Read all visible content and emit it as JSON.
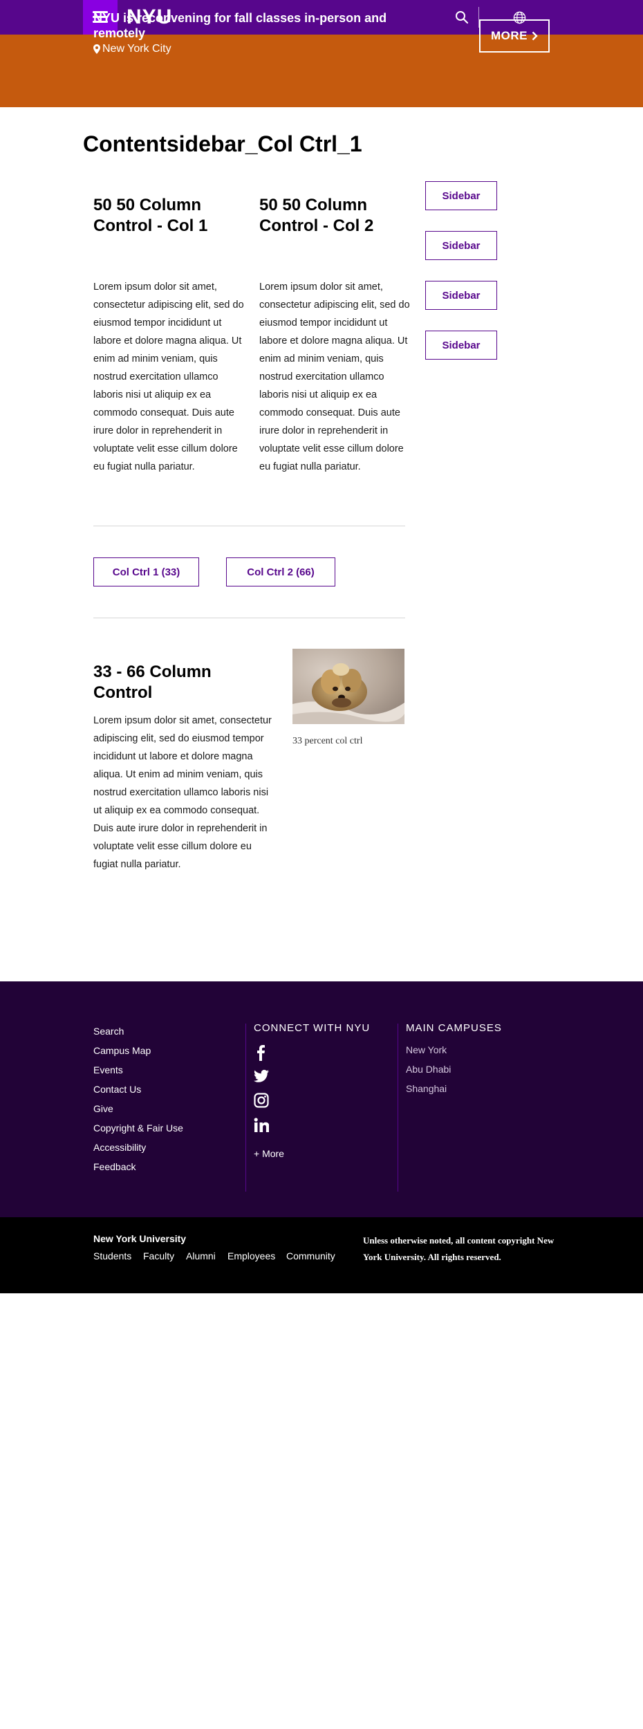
{
  "header": {
    "brand": "NYU",
    "menu_icon": "hamburger-menu-icon",
    "search_icon": "search-icon",
    "language_icon": "globe-icon",
    "colors": {
      "primary": "#57068c",
      "menu_accent": "#8900e1"
    }
  },
  "banner": {
    "title": "NYU is reconvening for fall classes in-person and remotely",
    "location": "New York City",
    "location_icon": "map-pin-icon",
    "more_label": "MORE",
    "more_icon": "chevron-right-icon",
    "color": "#c55a0e"
  },
  "main": {
    "page_title": "Contentsidebar_Col Ctrl_1",
    "col1": {
      "heading": "50 50 Column Control - Col 1",
      "body": "Lorem ipsum dolor sit amet, consectetur adipiscing elit, sed do eiusmod tempor incididunt ut labore et dolore magna aliqua. Ut enim ad minim veniam, quis nostrud exercitation ullamco laboris nisi ut aliquip ex ea commodo consequat. Duis aute irure dolor in reprehenderit in voluptate velit esse cillum dolore eu fugiat nulla pariatur."
    },
    "col2": {
      "heading": "50 50 Column Control - Col 2",
      "body": "Lorem ipsum dolor sit amet, consectetur adipiscing elit, sed do eiusmod tempor incididunt ut labore et dolore magna aliqua. Ut enim ad minim veniam, quis nostrud exercitation ullamco laboris nisi ut aliquip ex ea commodo consequat. Duis aute irure dolor in reprehenderit in voluptate velit esse cillum dolore eu fugiat nulla pariatur."
    },
    "sidebar_buttons": [
      "Sidebar",
      "Sidebar",
      "Sidebar",
      "Sidebar"
    ],
    "col_ctrl_buttons": [
      "Col Ctrl 1 (33)",
      "Col Ctrl 2 (66)"
    ],
    "section33": {
      "heading": "33 - 66 Column Control",
      "body": "Lorem ipsum dolor sit amet, consectetur adipiscing elit, sed do eiusmod tempor incididunt ut labore et dolore magna aliqua. Ut enim ad minim veniam, quis nostrud exercitation ullamco laboris nisi ut aliquip ex ea commodo consequat. Duis aute irure dolor in reprehenderit in voluptate velit esse cillum dolore eu fugiat nulla pariatur.",
      "image_caption": "33 percent col ctrl"
    }
  },
  "footer": {
    "links": [
      "Search",
      "Campus Map",
      "Events",
      "Contact Us",
      "Give",
      "Copyright & Fair Use",
      "Accessibility",
      "Feedback"
    ],
    "connect_heading": "CONNECT WITH NYU",
    "social_icons": [
      "facebook-icon",
      "twitter-icon",
      "instagram-icon",
      "linkedin-icon"
    ],
    "more_label": "+ More",
    "campuses_heading": "MAIN CAMPUSES",
    "campuses": [
      "New York",
      "Abu Dhabi",
      "Shanghai"
    ],
    "background": "#220337"
  },
  "bottom": {
    "title": "New York University",
    "links": [
      "Students",
      "Faculty",
      "Alumni",
      "Employees",
      "Community"
    ],
    "copyright": "Unless otherwise noted, all content copyright New York University. All rights reserved."
  }
}
